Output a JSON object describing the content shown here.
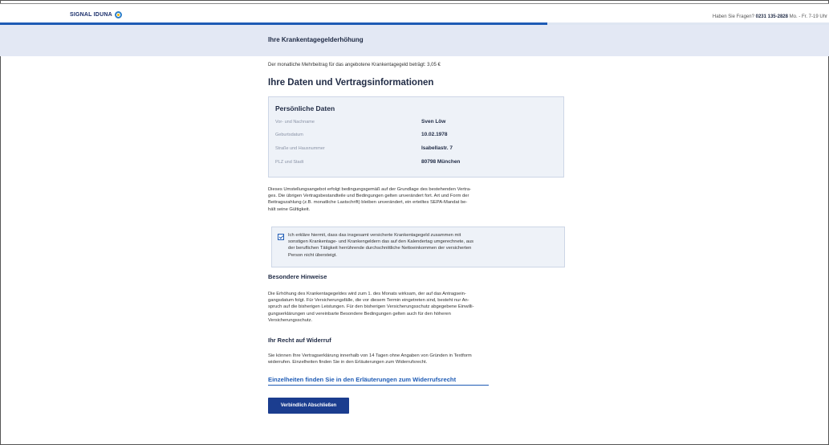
{
  "header": {
    "logo_text": "SIGNAL IDUNA",
    "help_prefix": "Haben Sie Fragen?",
    "help_phone": "0231 135-2828",
    "help_hours": "Mo. - Fr. 7-19 Uhr",
    "progress_percent": 66
  },
  "banner": {
    "title": "Ihre Krankentagegelderhöhung"
  },
  "main": {
    "intro": "Der monatliche Mehrbeitrag für das angebotene Krankentagegeld beträgt: 3,05 €",
    "heading": "Ihre Daten und Vertragsinformationen",
    "personal": {
      "title": "Persönliche Daten",
      "rows": [
        {
          "label": "Vor- und Nachname",
          "value": "Sven Löw"
        },
        {
          "label": "Geburtsdatum",
          "value": "10.02.1978"
        },
        {
          "label": "Straße und Hausnummer",
          "value": "Isabellastr. 7"
        },
        {
          "label": "PLZ und Stadt",
          "value": "80798 München"
        }
      ]
    },
    "conditions_lines": [
      "Dieses Umstellungsangebot erfolgt bedingungsgemäß auf der Grundlage des bestehenden Vertra-",
      "ges. Die übrigen Vertragsbestandteile und Bedingungen gelten unverändert fort. Art und Form der",
      "Beitragszahlung (z.B. monatliche Lastschrift) bleiben unverändert, ein erteiltes SEPA-Mandat be-",
      "hält seine Gültigkeit."
    ],
    "declaration_checked": true,
    "declaration_lines": [
      "Ich erkläre hiermit, dass das insgesamt versicherte Krankentagegeld zusammen mit",
      "sonstigen Krankentage- und Krankengeldern das auf den Kalendertag umgerechnete, aus",
      "der beruflichen Tätigkeit herrührende durchschnittliche Nettoeinkommen der versicherten",
      "Person nicht übersteigt."
    ],
    "notes_title": "Besondere Hinweise",
    "notes_lines": [
      "Die Erhöhung des Krankentagegeldes wird zum 1. des Monats wirksam, der auf das Antragsein-",
      "gangsdatum folgt. Für Versicherungsfälle, die vor diesem Termin eingetreten sind, besteht nur An-",
      "spruch auf die bisherigen Leistungen. Für den bisherigen Versicherungsschutz abgegebene Einwilli-",
      "gungserklärungen und vereinbarte Besondere Bedingungen gelten auch für den höheren",
      "Versicherungsschutz."
    ],
    "withdrawal_title": "Ihr Recht auf Widerruf",
    "withdrawal_lines": [
      "Sie können Ihre Vertragserklärung innerhalb von 14 Tagen ohne Angaben von Gründen in Textform",
      "widerrufen. Einzelheiten finden Sie in den Erläuterungen zum Widerrufsrecht."
    ],
    "withdrawal_link": "Einzelheiten finden Sie in den Erläuterungen zum Widerrufsrecht",
    "submit_label": "Verbindlich Abschließen"
  }
}
